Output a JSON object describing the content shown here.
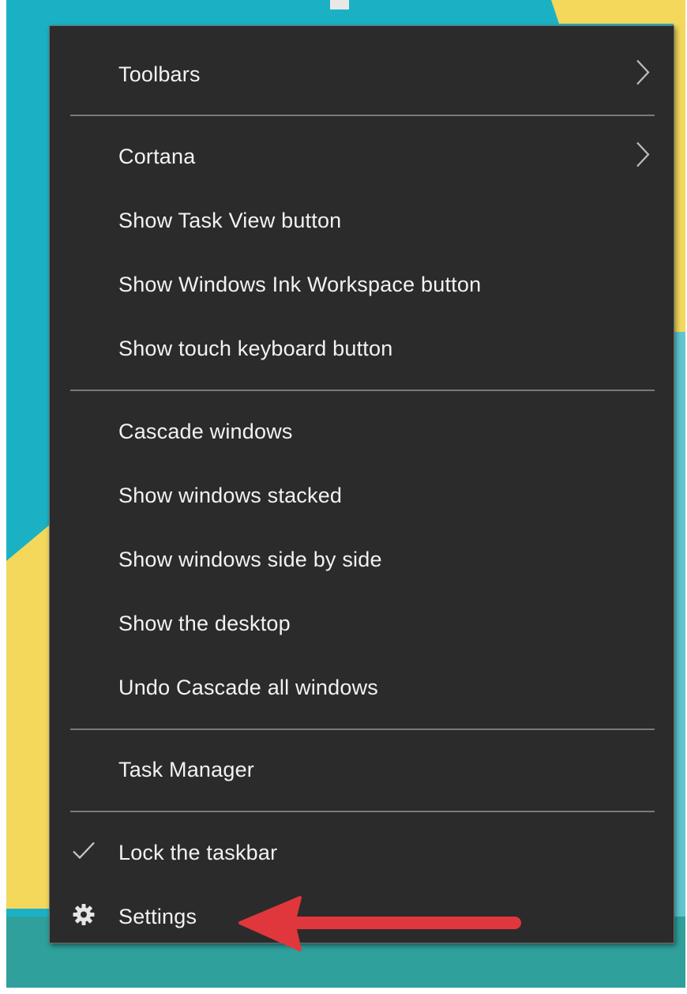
{
  "menu": {
    "items": [
      {
        "label": "Toolbars",
        "submenu": true
      },
      {
        "label": "Cortana",
        "submenu": true
      },
      {
        "label": "Show Task View button"
      },
      {
        "label": "Show Windows Ink Workspace button"
      },
      {
        "label": "Show touch keyboard button"
      },
      {
        "label": "Cascade windows"
      },
      {
        "label": "Show windows stacked"
      },
      {
        "label": "Show windows side by side"
      },
      {
        "label": "Show the desktop"
      },
      {
        "label": "Undo Cascade all windows"
      },
      {
        "label": "Task Manager"
      },
      {
        "label": "Lock the taskbar",
        "checked": true,
        "icon": "checkmark-icon"
      },
      {
        "label": "Settings",
        "icon": "gear-icon"
      }
    ]
  },
  "annotation": {
    "icon": "arrow-left-icon",
    "color": "#e0373d"
  },
  "colors": {
    "menu_bg": "#2b2b2b",
    "menu_text": "#f2f2f2",
    "desktop_teal": "#1bb1c4",
    "desktop_yellow": "#f3d85c",
    "taskbar_teal": "#2fa09c"
  }
}
